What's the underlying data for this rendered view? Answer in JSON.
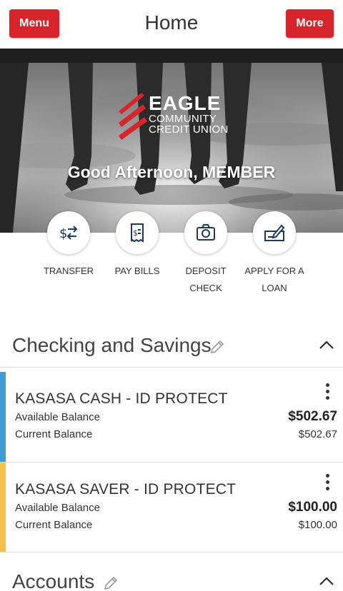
{
  "header": {
    "menu_label": "Menu",
    "title": "Home",
    "more_label": "More"
  },
  "hero": {
    "logo": {
      "line1": "EAGLE",
      "line2": "COMMUNITY",
      "line3": "CREDIT UNION"
    },
    "greeting": "Good Afternoon, MEMBER"
  },
  "quick_actions": [
    {
      "label_line1": "TRANSFER",
      "label_line2": "",
      "icon": "transfer-icon"
    },
    {
      "label_line1": "PAY BILLS",
      "label_line2": "",
      "icon": "bill-icon"
    },
    {
      "label_line1": "DEPOSIT",
      "label_line2": "CHECK",
      "icon": "camera-icon"
    },
    {
      "label_line1": "APPLY FOR A",
      "label_line2": "LOAN",
      "icon": "check-sign-icon"
    }
  ],
  "sections": [
    {
      "title": "Checking and Savings",
      "accounts": [
        {
          "name": "KASASA CASH - ID PROTECT",
          "available_label": "Available Balance",
          "available": "$502.67",
          "current_label": "Current Balance",
          "current": "$502.67",
          "color": "#3f9bd6"
        },
        {
          "name": "KASASA SAVER - ID PROTECT",
          "available_label": "Available Balance",
          "available": "$100.00",
          "current_label": "Current Balance",
          "current": "$100.00",
          "color": "#f3c14a"
        }
      ]
    },
    {
      "title": "Accounts",
      "accounts": []
    }
  ],
  "colors": {
    "brand_red": "#d8242b"
  }
}
